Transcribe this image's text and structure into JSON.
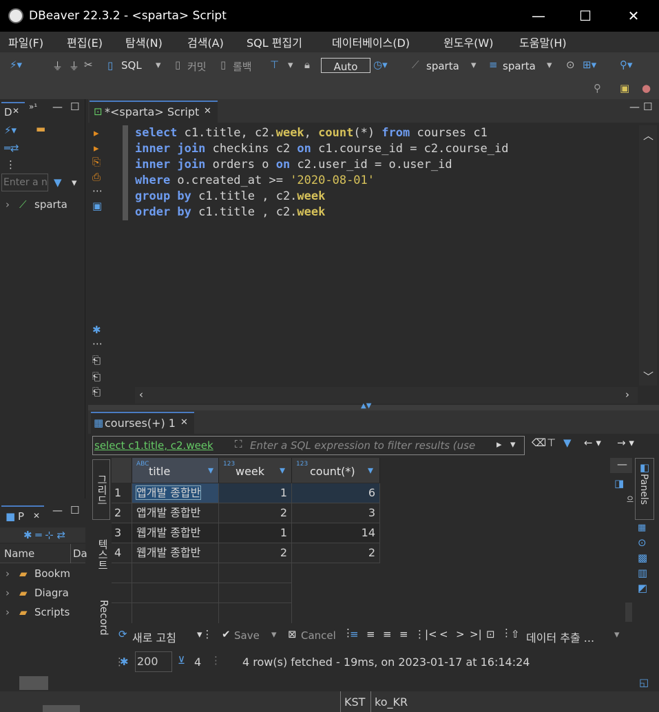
{
  "window": {
    "title": "DBeaver 22.3.2 - <sparta> Script",
    "minimize": "—",
    "maximize": "☐",
    "close": "✕"
  },
  "menu": [
    "파일(F)",
    "편집(E)",
    "탐색(N)",
    "검색(A)",
    "SQL 편집기",
    "데이터베이스(D)",
    "윈도우(W)",
    "도움말(H)"
  ],
  "toolbar": {
    "sql": "SQL",
    "commit": "커밋",
    "rollback": "롤백",
    "auto": "Auto",
    "datasource": "sparta",
    "schema": "sparta"
  },
  "left_panel": {
    "tab": "D",
    "filter_placeholder": "Enter a n",
    "tree_item": "sparta"
  },
  "projects": {
    "tab": "P",
    "col_name": "Name",
    "col_data": "Da",
    "items": [
      "Bookm",
      "Diagra",
      "Scripts"
    ]
  },
  "editor": {
    "tab_label": "*<sparta> Script",
    "lines": [
      "select c1.title, c2.week, count(*) from courses c1",
      "inner join checkins c2 on c1.course_id = c2.course_id",
      "inner join orders o on c2.user_id = o.user_id",
      "where o.created_at >= '2020-08-01'",
      "group by c1.title , c2.week",
      "order by c1.title , c2.week"
    ]
  },
  "results": {
    "tab_label": "courses(+) 1",
    "filter_query": "select c1.title, c2.week",
    "filter_placeholder": "Enter a SQL expression to filter results (use",
    "columns": [
      {
        "type_badge": "ABC",
        "name": "title"
      },
      {
        "type_badge": "123",
        "name": "week"
      },
      {
        "type_badge": "123",
        "name": "count(*)"
      }
    ],
    "rows": [
      {
        "num": "1",
        "title": "앱개발 종합반",
        "week": "1",
        "count": "6"
      },
      {
        "num": "2",
        "title": "앱개발 종합반",
        "week": "2",
        "count": "3"
      },
      {
        "num": "3",
        "title": "웹개발 종합반",
        "week": "1",
        "count": "14"
      },
      {
        "num": "4",
        "title": "웹개발 종합반",
        "week": "2",
        "count": "2"
      }
    ],
    "side_tabs": {
      "grid": "그리드",
      "text": "텍스트",
      "record": "Record"
    },
    "panels_label": "Panels",
    "refresh": "새로 고침",
    "save": "Save",
    "cancel": "Cancel",
    "export": "데이터 추출 ...",
    "fetch_size": "200",
    "row_count": "4",
    "status": "4 row(s) fetched - 19ms, on 2023-01-17 at 16:14:24"
  },
  "statusbar": {
    "tz": "KST",
    "locale": "ko_KR"
  },
  "colors": {
    "accent": "#4a7cc2",
    "keyword": "#6e9cf0",
    "string": "#d7c25a",
    "selected_cell": "#264f78"
  }
}
